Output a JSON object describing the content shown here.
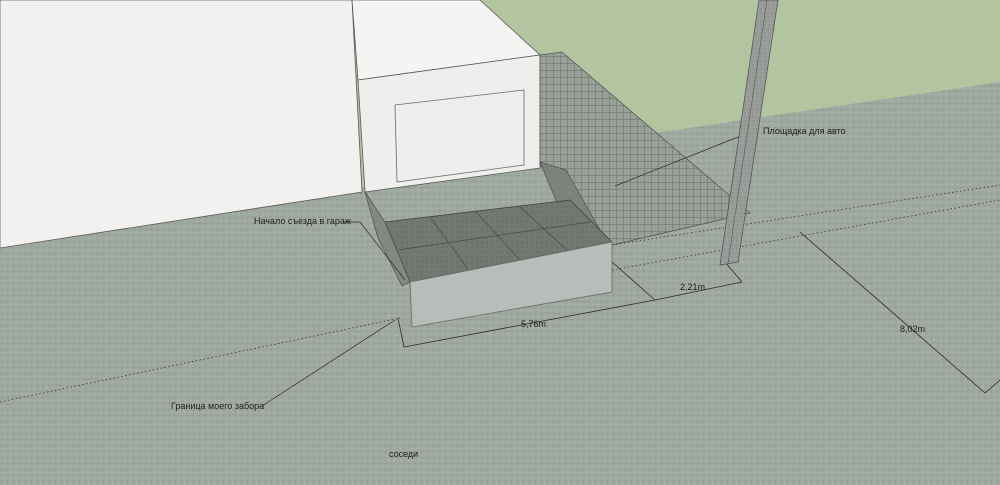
{
  "labels": {
    "garage_entry_start": "Начало съезда в гараж",
    "car_pad": "Площадка для авто",
    "fence_boundary": "Граница моего забора",
    "neighbors": "соседи"
  },
  "dimensions": {
    "width_pit": "5,76m",
    "offset_post": "2,21m",
    "long_span": "8,02m"
  },
  "colors": {
    "sky_grass": "#b3c5a0",
    "ground": "#9fa99f",
    "house_wall": "#f2f1ef",
    "garage_block": "#eeeeec",
    "grid_pad": "#8c958c",
    "pit_floor": "#6d726d",
    "retaining_wall": "#b9bdb9",
    "post": "#8f938f"
  }
}
